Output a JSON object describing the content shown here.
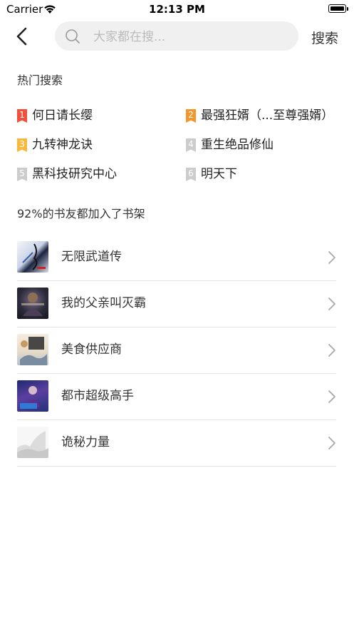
{
  "status_bar": {
    "carrier": "Carrier",
    "time": "12:13 PM"
  },
  "nav": {
    "search_placeholder": "大家都在搜...",
    "search_button": "搜索"
  },
  "hot_search": {
    "title": "热门搜索",
    "items": [
      {
        "rank": "1",
        "label": "何日请长缨",
        "badge_color": "#f2503c"
      },
      {
        "rank": "2",
        "label": "最强狂婿（...至尊强婿）",
        "badge_color": "#f6952c"
      },
      {
        "rank": "3",
        "label": "九转神龙诀",
        "badge_color": "#f6b93b"
      },
      {
        "rank": "4",
        "label": "重生绝品修仙",
        "badge_color": "#cccccc"
      },
      {
        "rank": "5",
        "label": "黑科技研究中心",
        "badge_color": "#cccccc"
      },
      {
        "rank": "6",
        "label": "明天下",
        "badge_color": "#cccccc"
      }
    ]
  },
  "shelf": {
    "title": "92%的书友都加入了书架",
    "books": [
      {
        "title": "无限武道传"
      },
      {
        "title": "我的父亲叫灭霸"
      },
      {
        "title": "美食供应商"
      },
      {
        "title": "都市超级高手"
      },
      {
        "title": "诡秘力量"
      }
    ]
  }
}
